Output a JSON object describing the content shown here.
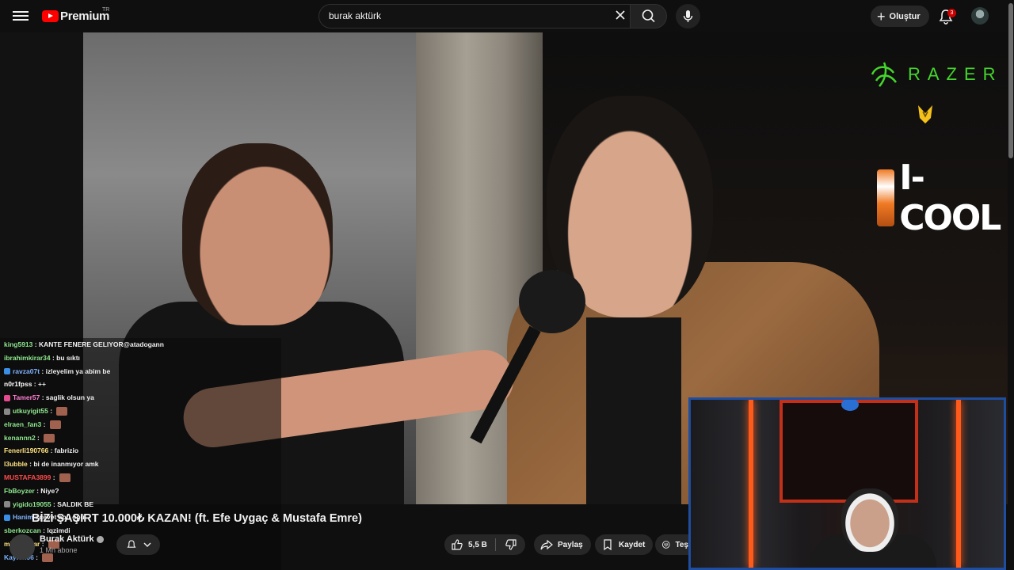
{
  "header": {
    "logo_text": "Premium",
    "country_code": "TR",
    "search_value": "burak aktürk",
    "create_label": "Oluştur",
    "notification_count": "3"
  },
  "video": {
    "title": "BİZİ ŞAŞIRT 10.000₺ KAZAN! (ft. Efe Uygaç & Mustafa Emre)",
    "overlays": {
      "razer_text": "RAZER",
      "icool_text": "I-COOL",
      "can_text": "I-COOL"
    }
  },
  "channel": {
    "name": "Burak Aktürk",
    "subscribers": "1 Mn abone"
  },
  "actions": {
    "like_count": "5,5 B",
    "share_label": "Paylaş",
    "save_label": "Kaydet",
    "thanks_label": "Teş"
  },
  "chat": {
    "rows": [
      {
        "user": "king5913",
        "msg": "KANTE FENERE GELIYOR@atadogann",
        "color": "#8fe98f"
      },
      {
        "user": "ibrahimkirar34",
        "msg": "bu sıktı",
        "color": "#8fe98f"
      },
      {
        "user": "ravza07t",
        "msg": "izleyelim ya abim be",
        "color": "#7fb4ff"
      },
      {
        "user": "n0r1fpss",
        "msg": "++",
        "color": "#ffffff"
      },
      {
        "user": "Tamer57",
        "msg": "saglik olsun ya",
        "color": "#ff7fd4"
      },
      {
        "user": "utkuyigit55",
        "msg": "",
        "color": "#8fe98f"
      },
      {
        "user": "elraen_fan3",
        "msg": "",
        "color": "#8fe98f"
      },
      {
        "user": "kenannn2",
        "msg": "",
        "color": "#8fe98f"
      },
      {
        "user": "Fenerli190766",
        "msg": "fabrizio",
        "color": "#ffe27f"
      },
      {
        "user": "l3ubble",
        "msg": "bi de inanmıyor amk",
        "color": "#ffe27f"
      },
      {
        "user": "MUSTAFA3899",
        "msg": "",
        "color": "#ff4a4a"
      },
      {
        "user": "FbBoyzer",
        "msg": "Niye?",
        "color": "#8fe98f"
      },
      {
        "user": "yigido19055",
        "msg": "SALDIK BE",
        "color": "#8fe98f"
      },
      {
        "user": "Hanim",
        "msg": "çevet abu öpü",
        "color": "#7fb4ff"
      },
      {
        "user": "sberkozcan",
        "msg": "lqzimdi",
        "color": "#8fe98f"
      },
      {
        "user": "miracatalar",
        "msg": "",
        "color": "#ffe27f"
      },
      {
        "user": "Kayrax06",
        "msg": "",
        "color": "#7fb4ff"
      }
    ]
  },
  "colors": {
    "brand_red": "#ff0000",
    "razer_green": "#44d62c",
    "cam_border": "#1f4da0",
    "led_orange": "#ff5a1a"
  },
  "icons": [
    "menu-icon",
    "youtube-logo-icon",
    "clear-icon",
    "search-icon",
    "mic-icon",
    "plus-icon",
    "bell-icon",
    "like-icon",
    "dislike-icon",
    "share-icon",
    "save-icon",
    "thanks-icon",
    "chevron-down-icon",
    "verified-icon"
  ]
}
